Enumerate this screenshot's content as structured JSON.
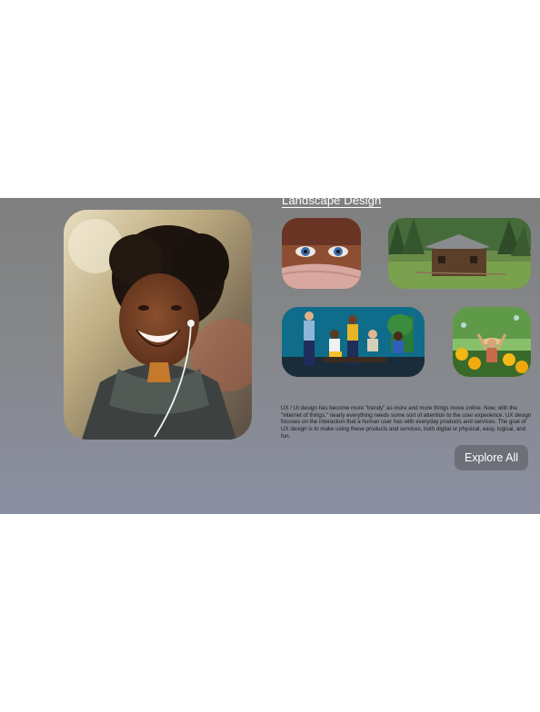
{
  "section": {
    "heading": "Landscape Design",
    "description": "UX / UI design has become more \"trendy\" as more and more things move online. Now, with the \"internet of things,\" nearly everything needs some sort of attention to the user experience. UX design focuses on the interaction that a human user has with everyday products and services. The goal of UX design is to make using these products and services, both digital or physical, easy, logical, and fun.",
    "cta_label": "Explore All"
  },
  "gallery": [
    {
      "name": "portrait-woman-headphones"
    },
    {
      "name": "eyes-close-up"
    },
    {
      "name": "log-cabin-forest"
    },
    {
      "name": "team-meeting"
    },
    {
      "name": "sunflower-field-celebration"
    }
  ]
}
